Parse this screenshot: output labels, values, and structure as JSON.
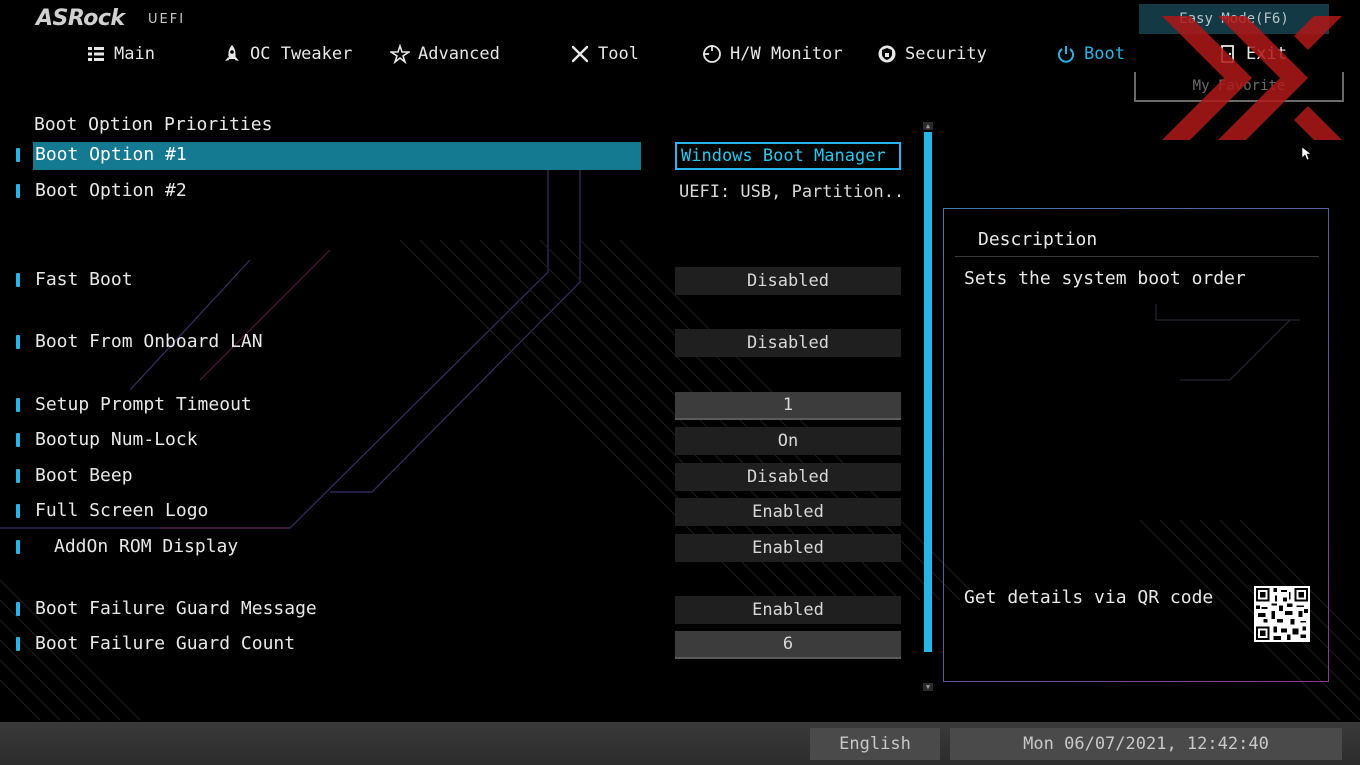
{
  "header": {
    "logo": "ASRock",
    "logo_sub": "UEFI",
    "easy_mode": "Easy Mode(F6)",
    "my_favorite": "My Favorite",
    "nav": [
      {
        "label": "Main",
        "icon": "list-icon"
      },
      {
        "label": "OC Tweaker",
        "icon": "rocket-icon"
      },
      {
        "label": "Advanced",
        "icon": "star-icon"
      },
      {
        "label": "Tool",
        "icon": "tools-icon"
      },
      {
        "label": "H/W Monitor",
        "icon": "crosshair-icon"
      },
      {
        "label": "Security",
        "icon": "shield-icon"
      },
      {
        "label": "Boot",
        "icon": "power-icon",
        "active": true
      },
      {
        "label": "Exit",
        "icon": "exit-door-icon"
      }
    ],
    "accent_color": "#27b4e6"
  },
  "main": {
    "section_title": "Boot Option Priorities",
    "settings": [
      {
        "label": "Boot Option #1",
        "value": "Windows Boot Manager ...",
        "selected": true
      },
      {
        "label": "Boot Option #2",
        "value": "UEFI:  USB, Partition..."
      },
      {
        "label": "Fast Boot",
        "value": "Disabled"
      },
      {
        "label": "Boot From Onboard LAN",
        "value": "Disabled"
      },
      {
        "label": "Setup Prompt Timeout",
        "value": "1"
      },
      {
        "label": "Bootup Num-Lock",
        "value": "On"
      },
      {
        "label": "Boot Beep",
        "value": "Disabled"
      },
      {
        "label": "Full Screen Logo",
        "value": "Enabled"
      },
      {
        "label": "AddOn ROM Display",
        "value": "Enabled"
      },
      {
        "label": "Boot Failure Guard Message",
        "value": "Enabled"
      },
      {
        "label": "Boot Failure Guard Count",
        "value": "6"
      }
    ]
  },
  "description": {
    "title": "Description",
    "text": "Sets the system boot order",
    "qr_label": "Get details via QR code"
  },
  "footer": {
    "language": "English",
    "datetime": "Mon 06/07/2021, 12:42:40"
  }
}
